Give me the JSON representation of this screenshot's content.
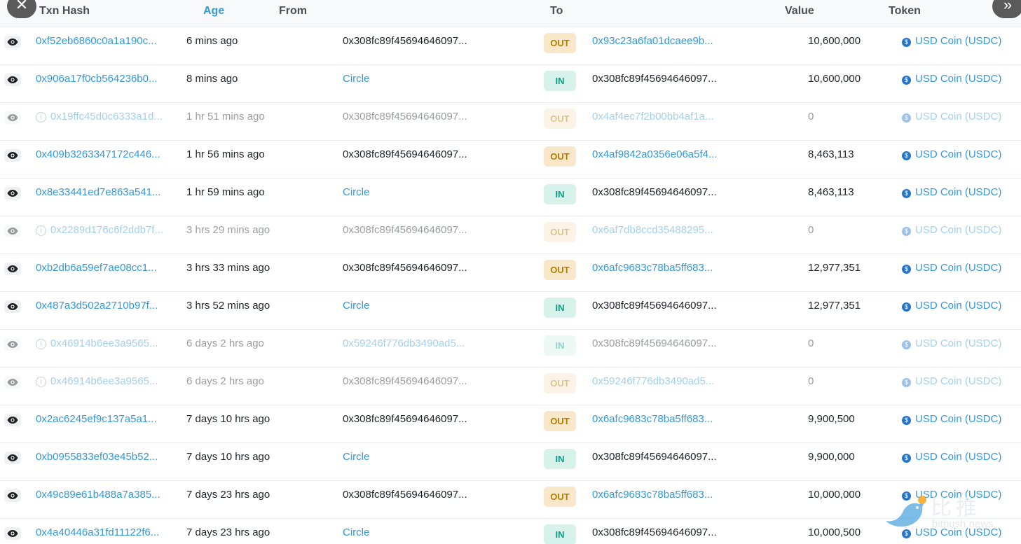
{
  "header": {
    "txn_hash": "Txn Hash",
    "age": "Age",
    "from": "From",
    "to": "To",
    "value": "Value",
    "token": "Token"
  },
  "controls": {
    "close_glyph": "✕",
    "expand_glyph": "»"
  },
  "icons": {
    "eye": "eye-icon",
    "info": "info-circle-icon",
    "token": "usdc-coin-icon",
    "close": "close-icon",
    "expand": "double-chevron-right-icon"
  },
  "colors": {
    "link": "#3498db",
    "out_badge_bg": "#f8e8c9",
    "out_badge_fg": "#b47d00",
    "in_badge_bg": "#d6f2ea",
    "in_badge_fg": "#00a186",
    "usdc": "#2775ca"
  },
  "rows": [
    {
      "hash": "0xf52eb6860c0a1a190c...",
      "age": "6 mins ago",
      "from": "0x308fc89f45694646097...",
      "from_is_link": false,
      "direction": "OUT",
      "to": "0x93c23a6fa01dcaee9b...",
      "to_is_link": true,
      "value": "10,600,000",
      "token": "USD Coin (USDC)",
      "failed": false
    },
    {
      "hash": "0x906a17f0cb564236b0...",
      "age": "8 mins ago",
      "from": "Circle",
      "from_is_link": true,
      "direction": "IN",
      "to": "0x308fc89f45694646097...",
      "to_is_link": false,
      "value": "10,600,000",
      "token": "USD Coin (USDC)",
      "failed": false
    },
    {
      "hash": "0x19ffc45d0c6333a1d...",
      "age": "1 hr 51 mins ago",
      "from": "0x308fc89f45694646097...",
      "from_is_link": false,
      "direction": "OUT",
      "to": "0x4af4ec7f2b00bb4af1a...",
      "to_is_link": true,
      "value": "0",
      "token": "USD Coin (USDC)",
      "failed": true
    },
    {
      "hash": "0x409b3263347172c446...",
      "age": "1 hr 56 mins ago",
      "from": "0x308fc89f45694646097...",
      "from_is_link": false,
      "direction": "OUT",
      "to": "0x4af9842a0356e06a5f4...",
      "to_is_link": true,
      "value": "8,463,113",
      "token": "USD Coin (USDC)",
      "failed": false
    },
    {
      "hash": "0x8e33441ed7e863a541...",
      "age": "1 hr 59 mins ago",
      "from": "Circle",
      "from_is_link": true,
      "direction": "IN",
      "to": "0x308fc89f45694646097...",
      "to_is_link": false,
      "value": "8,463,113",
      "token": "USD Coin (USDC)",
      "failed": false
    },
    {
      "hash": "0x2289d176c6f2ddb7f...",
      "age": "3 hrs 29 mins ago",
      "from": "0x308fc89f45694646097...",
      "from_is_link": false,
      "direction": "OUT",
      "to": "0x6af7db8ccd35488295...",
      "to_is_link": true,
      "value": "0",
      "token": "USD Coin (USDC)",
      "failed": true
    },
    {
      "hash": "0xb2db6a59ef7ae08cc1...",
      "age": "3 hrs 33 mins ago",
      "from": "0x308fc89f45694646097...",
      "from_is_link": false,
      "direction": "OUT",
      "to": "0x6afc9683c78ba5ff683...",
      "to_is_link": true,
      "value": "12,977,351",
      "token": "USD Coin (USDC)",
      "failed": false
    },
    {
      "hash": "0x487a3d502a2710b97f...",
      "age": "3 hrs 52 mins ago",
      "from": "Circle",
      "from_is_link": true,
      "direction": "IN",
      "to": "0x308fc89f45694646097...",
      "to_is_link": false,
      "value": "12,977,351",
      "token": "USD Coin (USDC)",
      "failed": false
    },
    {
      "hash": "0x46914b6ee3a9565...",
      "age": "6 days 2 hrs ago",
      "from": "0x59246f776db3490ad5...",
      "from_is_link": true,
      "direction": "IN",
      "to": "0x308fc89f45694646097...",
      "to_is_link": false,
      "value": "0",
      "token": "USD Coin (USDC)",
      "failed": true
    },
    {
      "hash": "0x46914b6ee3a9565...",
      "age": "6 days 2 hrs ago",
      "from": "0x308fc89f45694646097...",
      "from_is_link": false,
      "direction": "OUT",
      "to": "0x59246f776db3490ad5...",
      "to_is_link": true,
      "value": "0",
      "token": "USD Coin (USDC)",
      "failed": true
    },
    {
      "hash": "0x2ac6245ef9c137a5a1...",
      "age": "7 days 10 hrs ago",
      "from": "0x308fc89f45694646097...",
      "from_is_link": false,
      "direction": "OUT",
      "to": "0x6afc9683c78ba5ff683...",
      "to_is_link": true,
      "value": "9,900,500",
      "token": "USD Coin (USDC)",
      "failed": false
    },
    {
      "hash": "0xb0955833ef03e45b52...",
      "age": "7 days 10 hrs ago",
      "from": "Circle",
      "from_is_link": true,
      "direction": "IN",
      "to": "0x308fc89f45694646097...",
      "to_is_link": false,
      "value": "9,900,000",
      "token": "USD Coin (USDC)",
      "failed": false
    },
    {
      "hash": "0x49c89e61b488a7a385...",
      "age": "7 days 23 hrs ago",
      "from": "0x308fc89f45694646097...",
      "from_is_link": false,
      "direction": "OUT",
      "to": "0x6afc9683c78ba5ff683...",
      "to_is_link": true,
      "value": "10,000,000",
      "token": "USD Coin (USDC)",
      "failed": false
    },
    {
      "hash": "0x4a40446a31fd11122f6...",
      "age": "7 days 23 hrs ago",
      "from": "Circle",
      "from_is_link": true,
      "direction": "IN",
      "to": "0x308fc89f45694646097...",
      "to_is_link": false,
      "value": "10,000,500",
      "token": "USD Coin (USDC)",
      "failed": false
    }
  ],
  "watermark": {
    "brand": "比推",
    "domain": "bitpush.news"
  }
}
